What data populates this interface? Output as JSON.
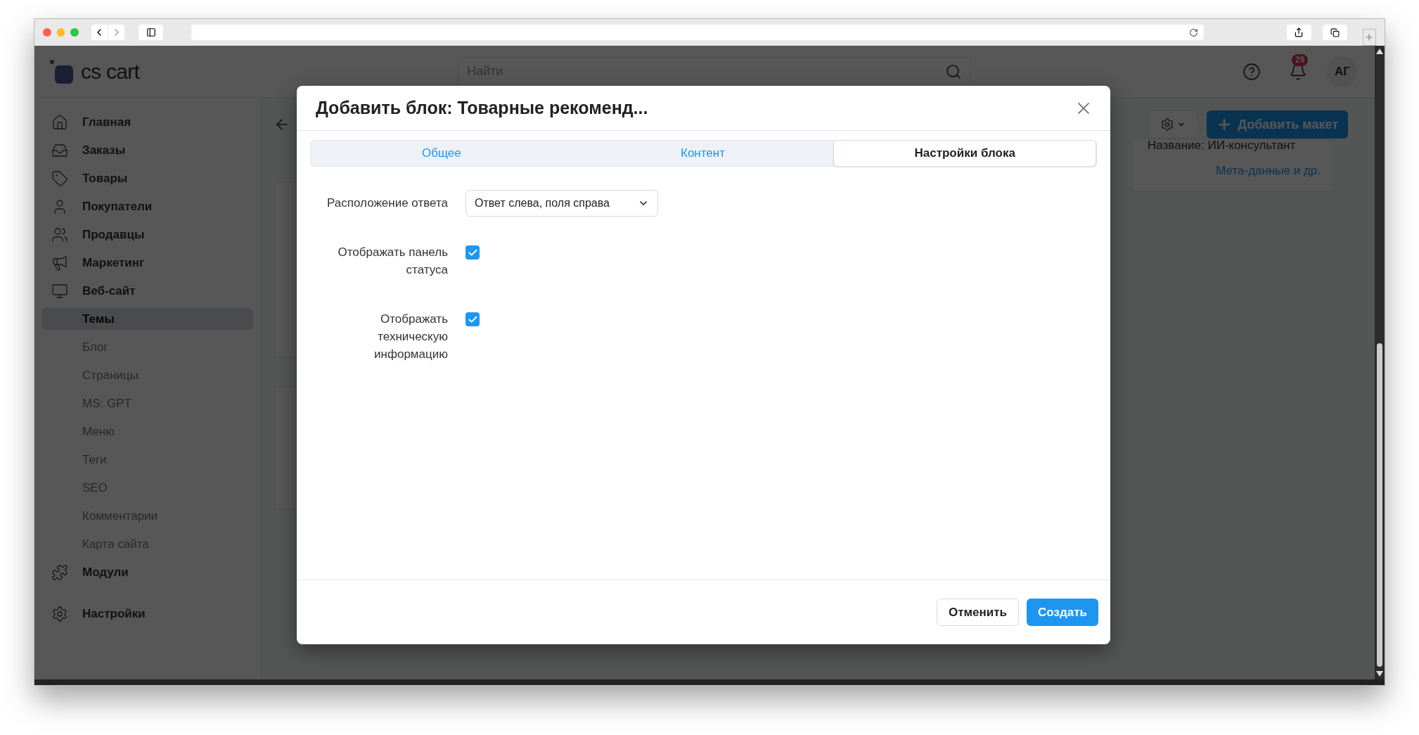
{
  "header": {
    "logo": "cs cart",
    "search_placeholder": "Найти",
    "notification_count": "29",
    "avatar": "АГ"
  },
  "sidebar": {
    "items": [
      {
        "label": "Главная",
        "kind": "section",
        "selected": false
      },
      {
        "label": "Заказы",
        "kind": "section",
        "selected": false
      },
      {
        "label": "Товары",
        "kind": "section",
        "selected": false
      },
      {
        "label": "Покупатели",
        "kind": "section",
        "selected": false
      },
      {
        "label": "Продавцы",
        "kind": "section",
        "selected": false
      },
      {
        "label": "Маркетинг",
        "kind": "section",
        "selected": false
      },
      {
        "label": "Веб-сайт",
        "kind": "section",
        "selected": false
      },
      {
        "label": "Темы",
        "kind": "sub",
        "selected": true
      },
      {
        "label": "Блог",
        "kind": "sub",
        "selected": false
      },
      {
        "label": "Страницы",
        "kind": "sub",
        "selected": false
      },
      {
        "label": "MS: GPT",
        "kind": "sub",
        "selected": false
      },
      {
        "label": "Меню",
        "kind": "sub",
        "selected": false
      },
      {
        "label": "Теги",
        "kind": "sub",
        "selected": false
      },
      {
        "label": "SEO",
        "kind": "sub",
        "selected": false
      },
      {
        "label": "Комментарии",
        "kind": "sub",
        "selected": false
      },
      {
        "label": "Карта сайта",
        "kind": "sub",
        "selected": false
      },
      {
        "label": "Модули",
        "kind": "section",
        "selected": false
      },
      {
        "label": "Настройки",
        "kind": "section",
        "selected": false
      }
    ]
  },
  "page": {
    "add_button": "Добавить макет",
    "info_card": {
      "name_line": "Название: ИИ-консультант",
      "link": "Мета-данные и др."
    }
  },
  "dialog": {
    "title": "Добавить блок: Товарные рекоменд...",
    "tabs": [
      {
        "label": "Общее",
        "selected": false
      },
      {
        "label": "Контент",
        "selected": false
      },
      {
        "label": "Настройки блока",
        "selected": true
      }
    ],
    "fields": [
      {
        "kind": "select",
        "label": "Расположение ответа",
        "value": "Ответ слева, поля справа"
      },
      {
        "kind": "checkbox",
        "label": "Отображать панель статуса",
        "checked": true
      },
      {
        "kind": "checkbox",
        "label": "Отображать техническую информацию",
        "checked": true
      }
    ],
    "buttons": [
      {
        "label": "Отменить",
        "kind": "secondary"
      },
      {
        "label": "Создать",
        "kind": "primary"
      }
    ]
  }
}
